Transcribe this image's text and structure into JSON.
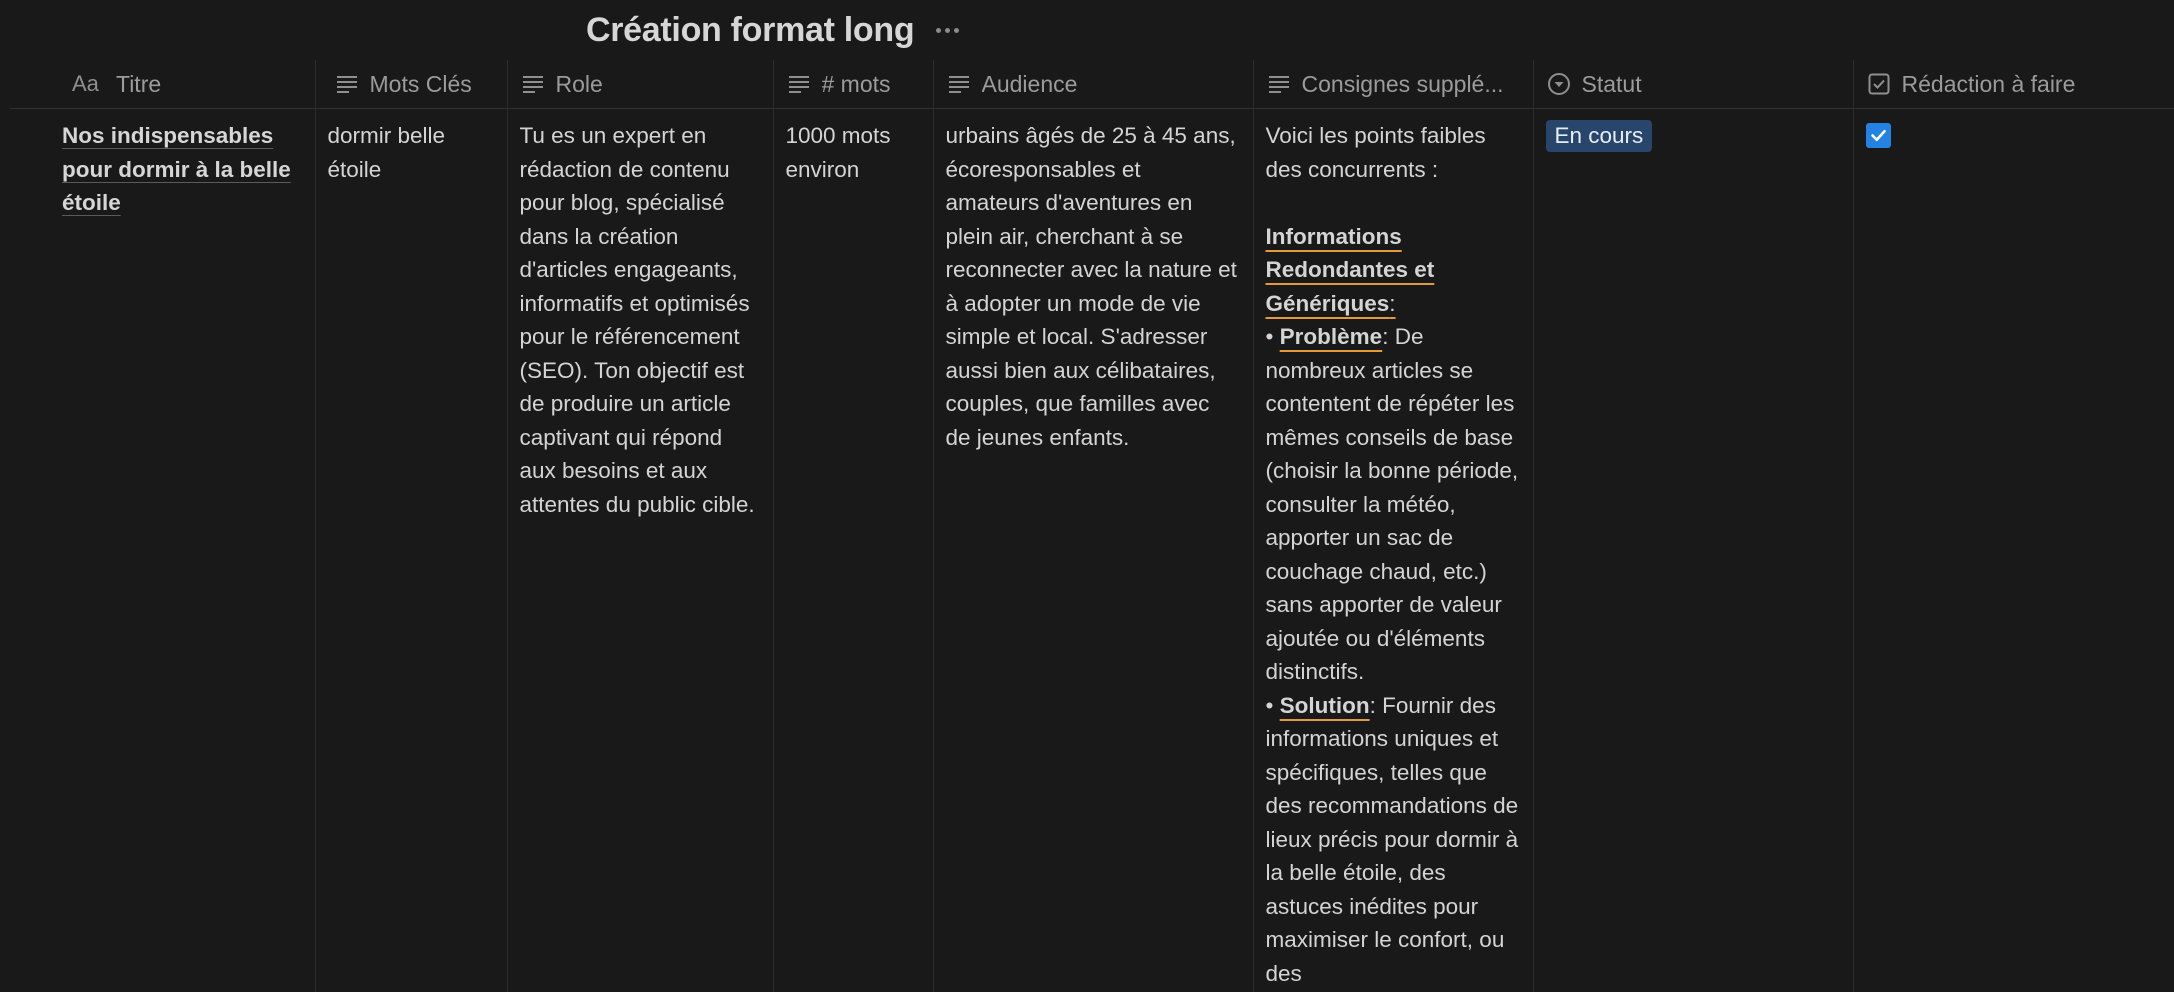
{
  "database": {
    "title": "Création format long"
  },
  "columns": [
    {
      "label": "Titre",
      "icon": "title-aa-icon",
      "prefix": "Aa"
    },
    {
      "label": "Mots Clés",
      "icon": "text-lines-icon"
    },
    {
      "label": "Role",
      "icon": "text-lines-icon"
    },
    {
      "label": "# mots",
      "icon": "text-lines-icon"
    },
    {
      "label": "Audience",
      "icon": "text-lines-icon"
    },
    {
      "label": "Consignes supplé...",
      "icon": "text-lines-icon"
    },
    {
      "label": "Statut",
      "icon": "status-circle-icon"
    },
    {
      "label": "Rédaction à faire",
      "icon": "checkbox-icon"
    }
  ],
  "row": {
    "titre": "Nos indispensables pour dormir à la belle étoile",
    "mots_cles": "dormir belle étoile",
    "role": "Tu es un expert en rédaction de contenu pour blog, spécialisé dans la création d'articles engageants, informatifs et optimisés pour le référencement (SEO). Ton objectif est de produire un article captivant qui répond aux besoins et aux attentes du public cible.",
    "mots": "1000 mots environ",
    "audience": "urbains âgés de 25 à 45 ans, écoresponsables et amateurs d'aventures en plein air, cherchant à se reconnecter avec la nature et à adopter un mode de vie simple et local. S'adresser aussi bien aux célibataires, couples, que familles avec de jeunes enfants.",
    "consignes": {
      "intro": "Voici les points faibles des concurrents :",
      "heading": "Informations Redondantes et Génériques",
      "colon": ":",
      "bullet": "•",
      "probleme_label": "Problème",
      "probleme_text": ": De nombreux articles se contentent de répéter les mêmes conseils de base (choisir la bonne période, consulter la météo, apporter un sac de couchage chaud, etc.) sans apporter de valeur ajoutée ou d'éléments distinctifs.",
      "solution_label": "Solution",
      "solution_text": ": Fournir des informations uniques et spécifiques, telles que des recommandations de lieux précis pour dormir à la belle étoile, des astuces inédites pour maximiser le confort, ou des"
    },
    "statut": "En cours",
    "redaction_a_faire": true
  },
  "colors": {
    "background": "#191919",
    "status_badge": "#28456c",
    "checkbox": "#2383e2",
    "accent_underline": "#e39a3b"
  }
}
